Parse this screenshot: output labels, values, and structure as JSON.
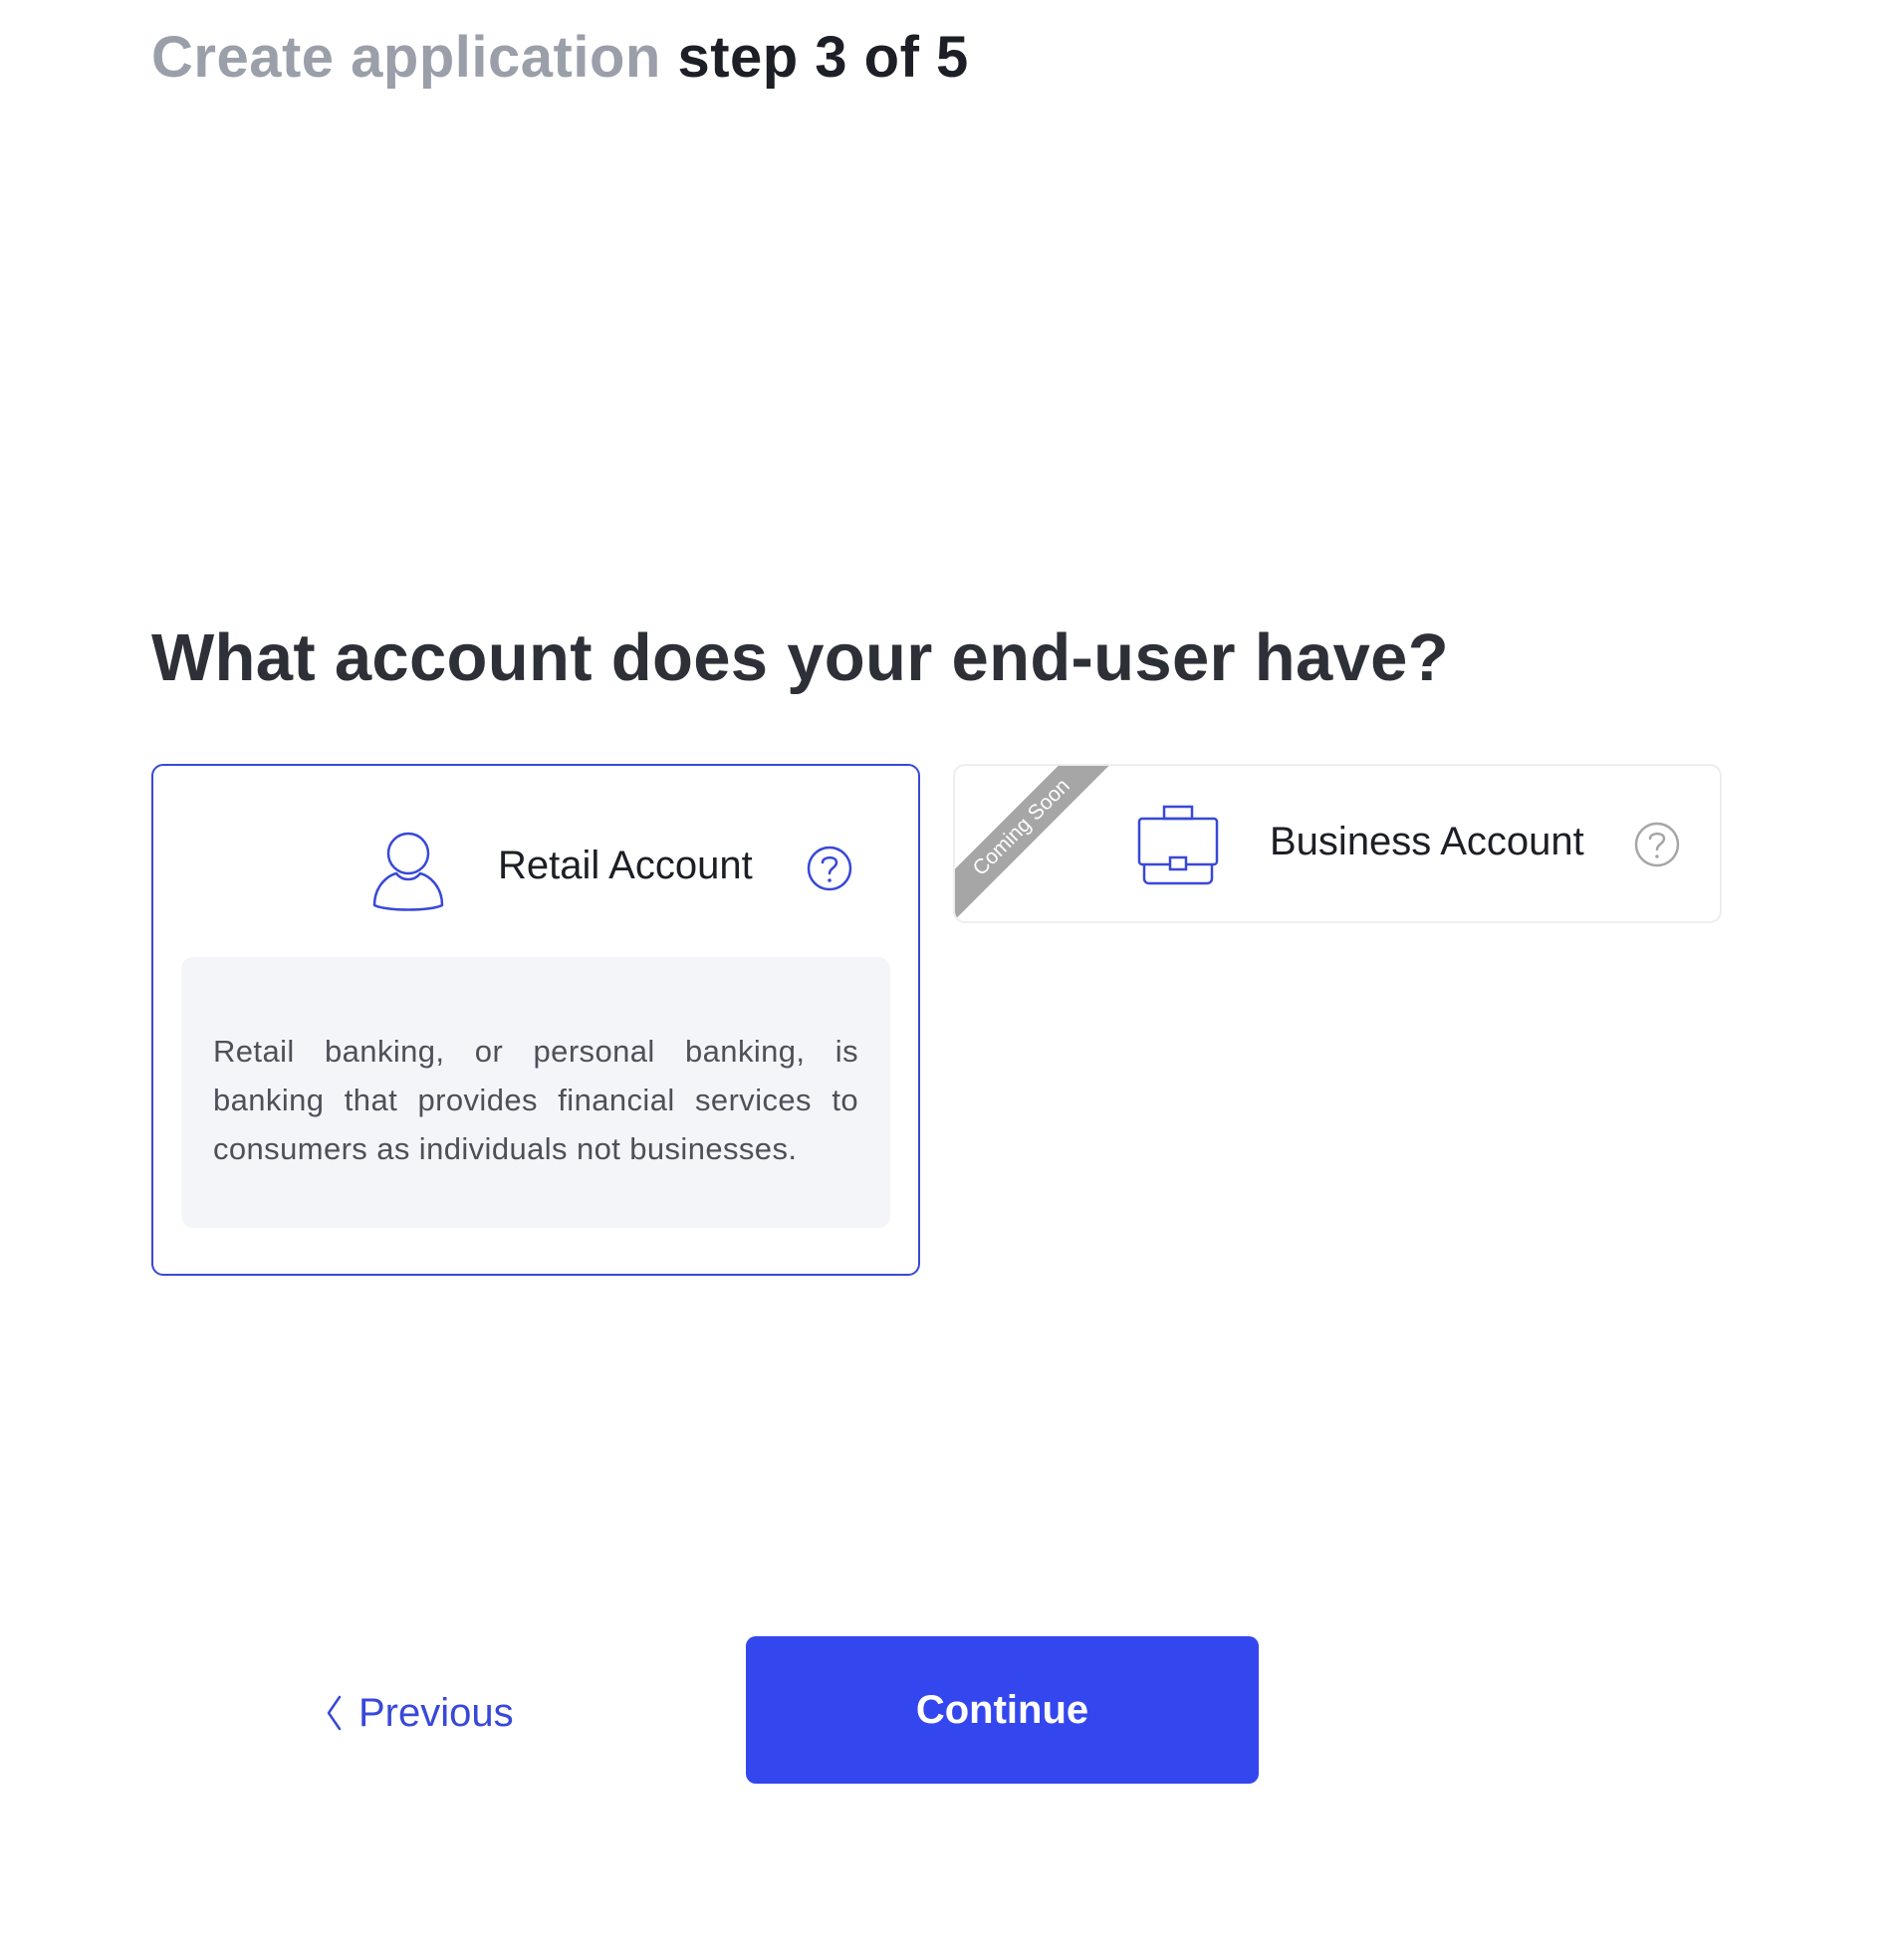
{
  "header": {
    "prefix": "Create application",
    "step": "step 3 of 5"
  },
  "question": "What account does your end-user have?",
  "options": {
    "retail": {
      "label": "Retail Account",
      "icon": "user-icon",
      "help_icon": "question-circle-icon",
      "selected": true,
      "description": "Retail banking, or personal banking, is banking that provides financial services to consumers as individuals not businesses."
    },
    "business": {
      "label": "Business Account",
      "icon": "briefcase-icon",
      "help_icon": "question-circle-icon",
      "ribbon": "Coming Soon",
      "selected": false
    }
  },
  "footer": {
    "previous_label": "Previous",
    "continue_label": "Continue"
  },
  "colors": {
    "accent": "#3447ee",
    "selected_border": "#3848d8",
    "header_prefix": "#9a9fa9",
    "ribbon": "#a6a6a6",
    "description_bg": "#f4f5f9"
  }
}
